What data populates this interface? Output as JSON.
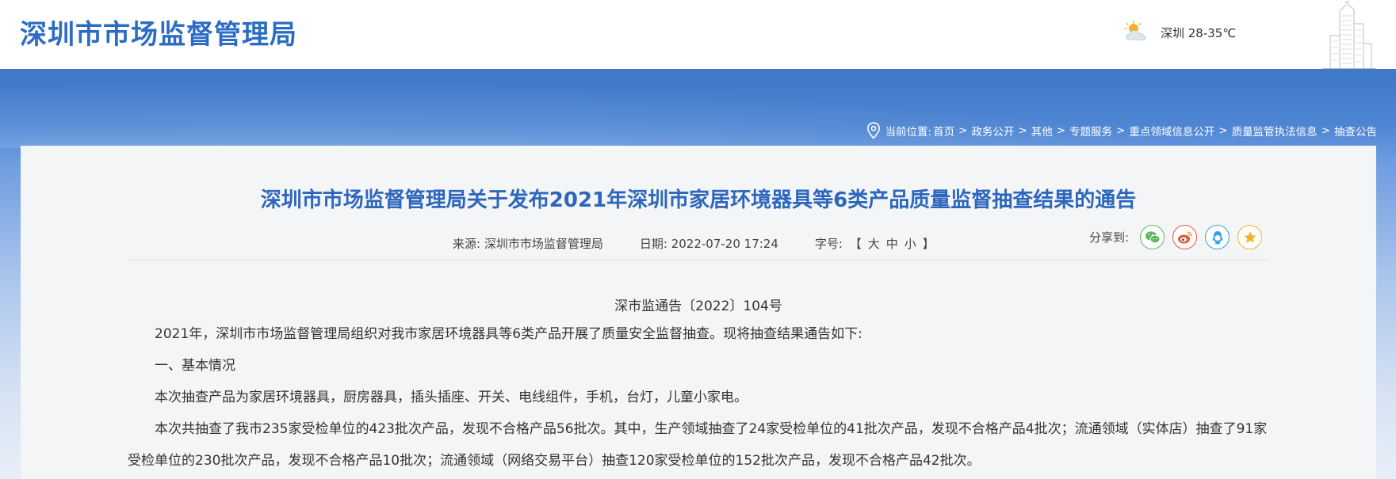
{
  "header": {
    "site_title": "深圳市市场监督管理局",
    "weather_icon": "partly-cloudy-icon",
    "weather_text": "深圳 28-35℃"
  },
  "breadcrumb": {
    "label": "当前位置:",
    "items": [
      "首页",
      "政务公开",
      "其他",
      "专题服务",
      "重点领域信息公开",
      "质量监管执法信息",
      "抽查公告"
    ],
    "separator": ">"
  },
  "article": {
    "title": "深圳市市场监督管理局关于发布2021年深圳市家居环境器具等6类产品质量监督抽查结果的通告",
    "source_label": "来源:",
    "source_value": "深圳市市场监督管理局",
    "date_label": "日期:",
    "date_value": "2022-07-20 17:24",
    "size_label": "字号:",
    "size_open": "【",
    "size_large": "大",
    "size_medium": "中",
    "size_small": "小",
    "size_close": "】",
    "share_label": "分享到:",
    "share_buttons": [
      {
        "name": "wechat",
        "color": "#5cb85c"
      },
      {
        "name": "weibo",
        "color": "#e9573f"
      },
      {
        "name": "qq",
        "color": "#3aa0e8"
      },
      {
        "name": "favorite",
        "color": "#f0b429"
      }
    ],
    "doc_number": "深市监通告〔2022〕104号",
    "paragraphs": [
      "2021年，深圳市市场监督管理局组织对我市家居环境器具等6类产品开展了质量安全监督抽查。现将抽查结果通告如下:",
      "一、基本情况",
      "本次抽查产品为家居环境器具，厨房器具，插头插座、开关、电线组件，手机，台灯，儿童小家电。",
      "本次共抽查了我市235家受检单位的423批次产品，发现不合格产品56批次。其中，生产领域抽查了24家受检单位的41批次产品，发现不合格产品4批次；流通领域（实体店）抽查了91家受检单位的230批次产品，发现不合格产品10批次；流通领域（网络交易平台）抽查120家受检单位的152批次产品，发现不合格产品42批次。"
    ]
  },
  "colors": {
    "brand_blue": "#2b6cc4",
    "title_blue": "#2d66bd"
  }
}
